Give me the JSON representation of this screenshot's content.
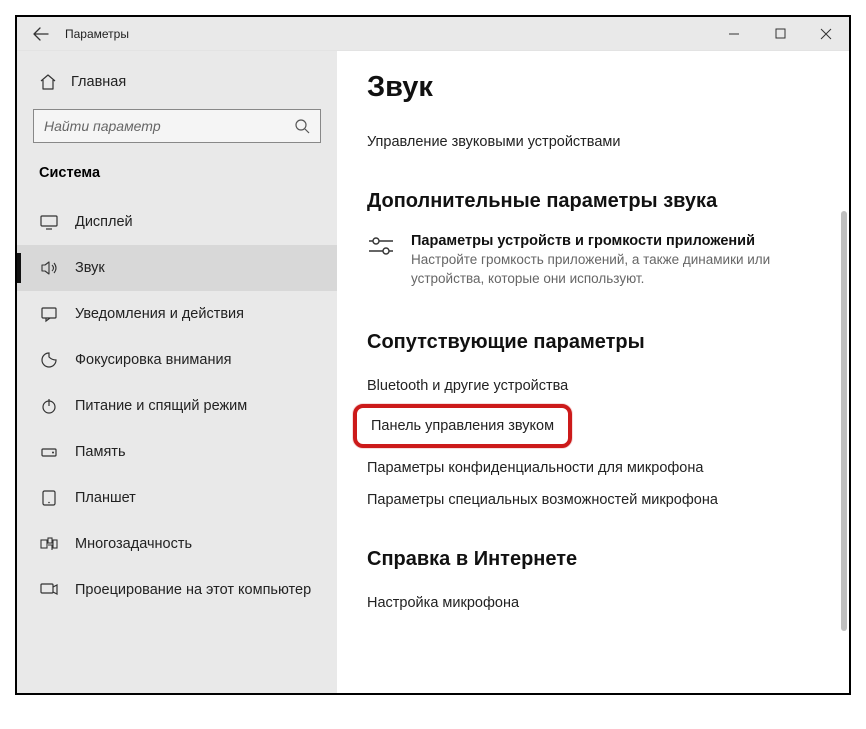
{
  "window": {
    "title": "Параметры"
  },
  "sidebar": {
    "home": "Главная",
    "search_placeholder": "Найти параметр",
    "category": "Система",
    "items": [
      {
        "icon": "display-icon",
        "label": "Дисплей"
      },
      {
        "icon": "sound-icon",
        "label": "Звук",
        "active": true
      },
      {
        "icon": "notifications-icon",
        "label": "Уведомления и действия"
      },
      {
        "icon": "focus-icon",
        "label": "Фокусировка внимания"
      },
      {
        "icon": "power-icon",
        "label": "Питание и спящий режим"
      },
      {
        "icon": "storage-icon",
        "label": "Память"
      },
      {
        "icon": "tablet-icon",
        "label": "Планшет"
      },
      {
        "icon": "multitask-icon",
        "label": "Многозадачность"
      },
      {
        "icon": "project-icon",
        "label": "Проецирование на этот компьютер"
      }
    ]
  },
  "main": {
    "title": "Звук",
    "manage_devices": "Управление звуковыми устройствами",
    "advanced": {
      "heading": "Дополнительные параметры звука",
      "item_title": "Параметры устройств и громкости приложений",
      "item_desc": "Настройте громкость приложений, а также динамики или устройства, которые они используют."
    },
    "related": {
      "heading": "Сопутствующие параметры",
      "links": [
        "Bluetooth и другие устройства",
        "Панель управления звуком",
        "Параметры конфиденциальности для микрофона",
        "Параметры специальных возможностей микрофона"
      ]
    },
    "help": {
      "heading": "Справка в Интернете",
      "link1": "Настройка микрофона"
    }
  }
}
